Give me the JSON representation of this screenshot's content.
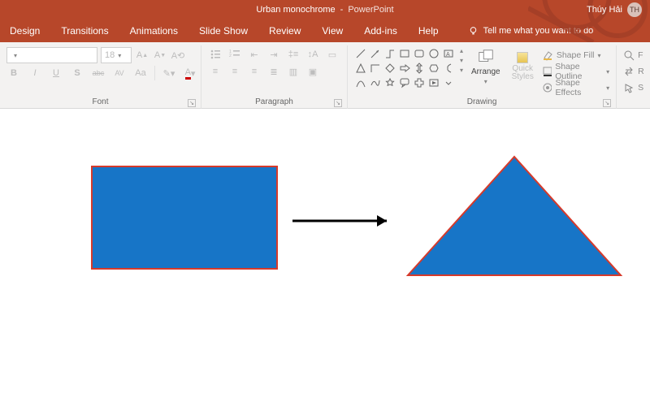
{
  "titlebar": {
    "doc": "Urban monochrome",
    "app": "PowerPoint",
    "user_name": "Thúy Hải",
    "user_initials": "TH"
  },
  "tabs": {
    "design": "Design",
    "transitions": "Transitions",
    "animations": "Animations",
    "slideshow": "Slide Show",
    "review": "Review",
    "view": "View",
    "addins": "Add-ins",
    "help": "Help",
    "tellme": "Tell me what you want to do"
  },
  "font": {
    "family_placeholder": "",
    "size": "18",
    "bold": "B",
    "italic": "I",
    "underline": "U",
    "strike": "S",
    "shadow": "abc",
    "charspace": "AV",
    "changecase": "Aa",
    "label": "Font"
  },
  "paragraph": {
    "label": "Paragraph"
  },
  "drawing": {
    "arrange": "Arrange",
    "quick_styles": "Quick\nStyles",
    "fill": "Shape Fill",
    "outline": "Shape Outline",
    "effects": "Shape Effects",
    "label": "Drawing"
  },
  "editing": {
    "find": "F",
    "replace": "R",
    "select": "S"
  },
  "colors": {
    "accent": "#b7472a",
    "shape_fill": "#1775c7",
    "shape_border": "#d63a2b"
  }
}
